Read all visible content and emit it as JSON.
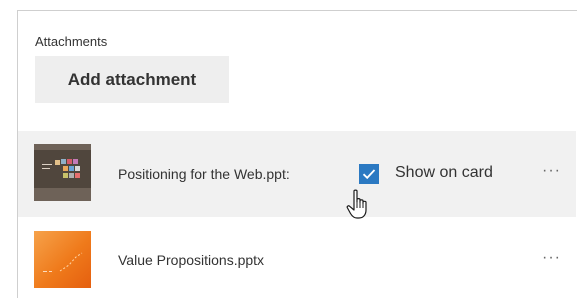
{
  "attachments": {
    "label": "Attachments",
    "add_button_label": "Add attachment",
    "items": [
      {
        "file_name": "Positioning for the Web.ppt:",
        "thumbnail_icon": "presentation-thumbnail-dark",
        "show_on_card_label": "Show on card",
        "show_on_card_checked": true,
        "more_label": "···"
      },
      {
        "file_name": "Value Propositions.pptx",
        "thumbnail_icon": "presentation-thumbnail-orange",
        "more_label": "···"
      }
    ]
  },
  "colors": {
    "selected_row_bg": "#f1f1f1",
    "checkbox_accent": "#2b79c2",
    "button_bg": "#eeeeee",
    "text": "#333333"
  },
  "cursor": "hand-pointer-icon"
}
